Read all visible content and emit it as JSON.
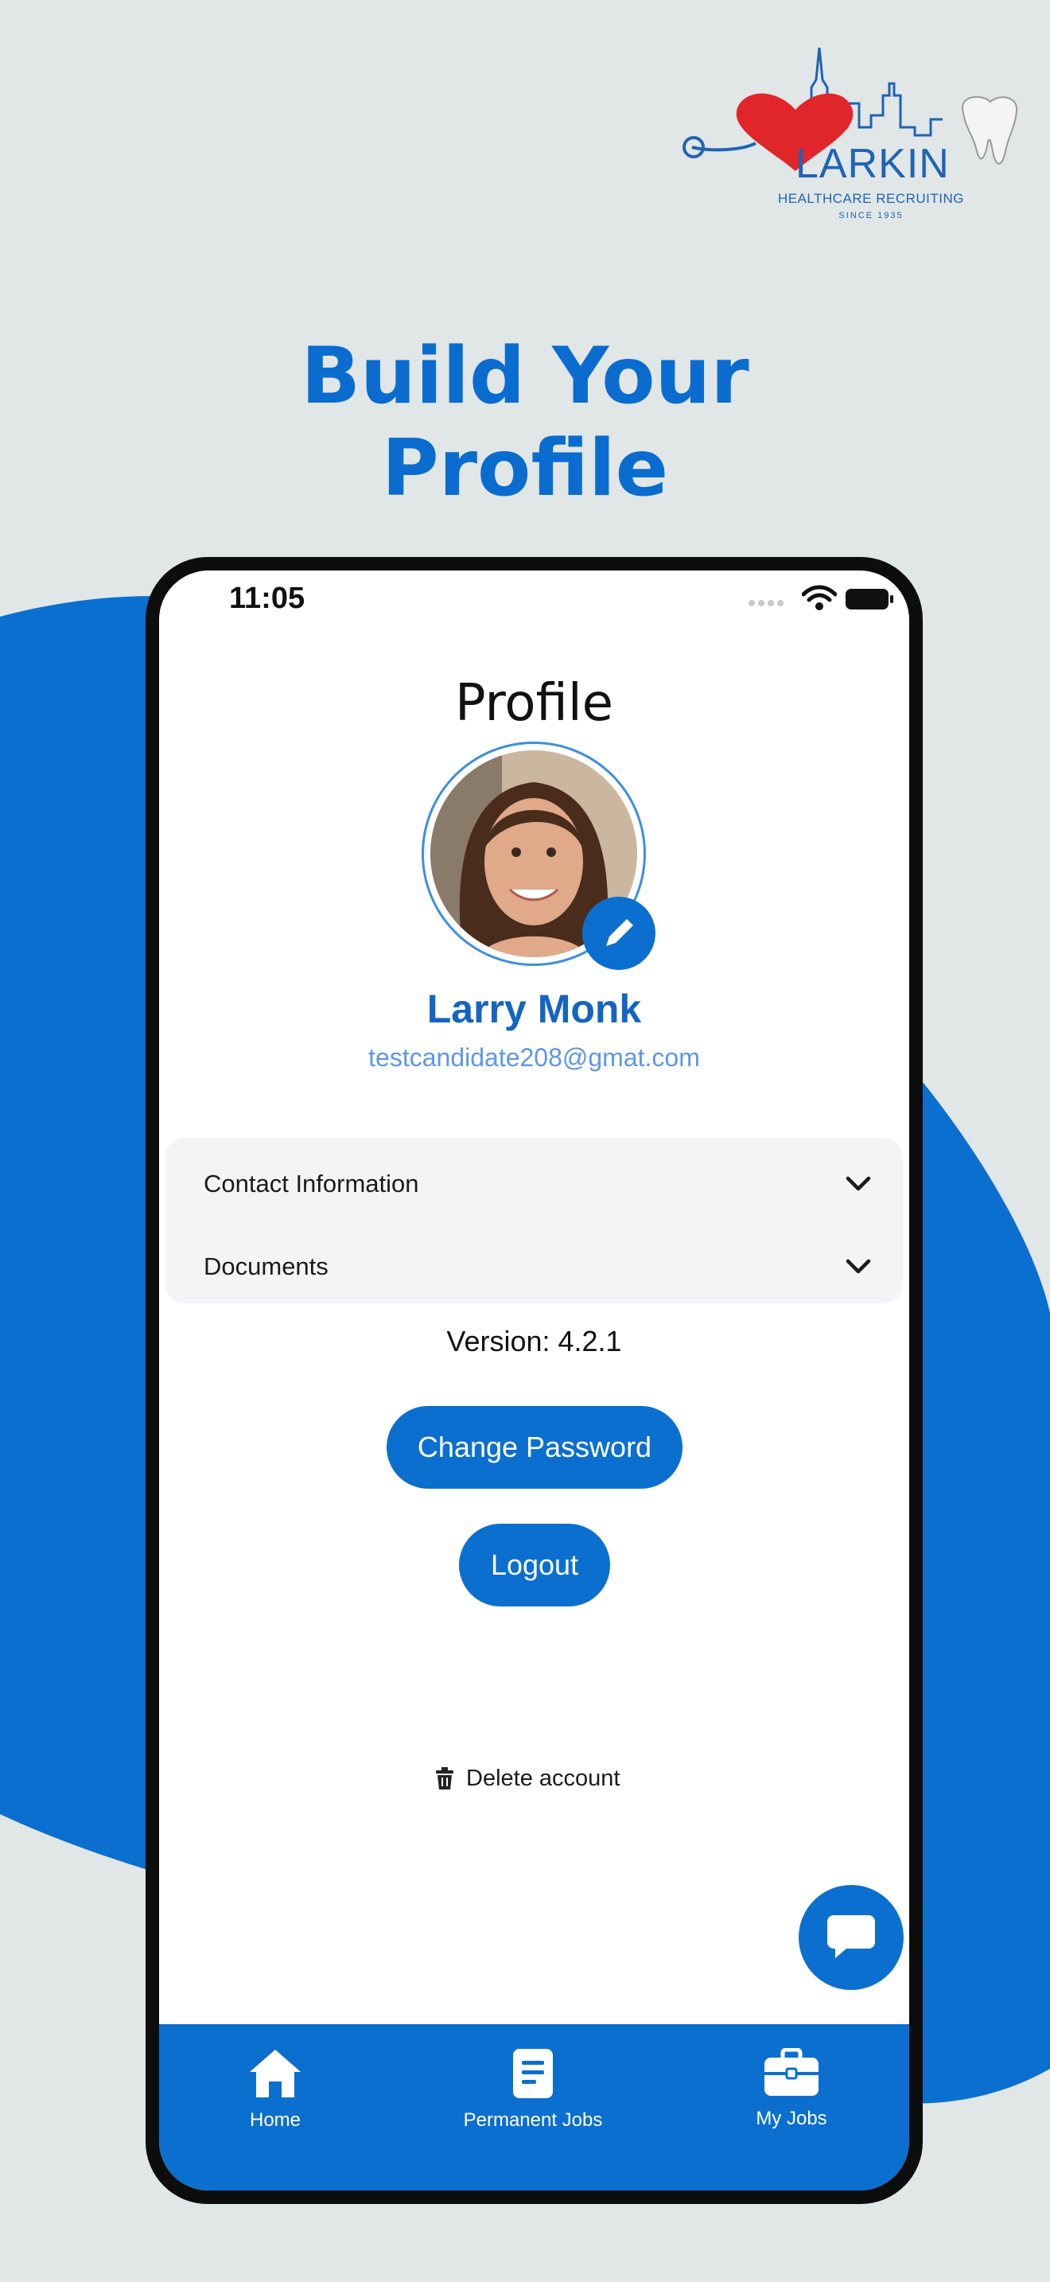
{
  "brand": {
    "name": "LARKIN",
    "subtitle": "HEALTHCARE RECRUITING",
    "since": "SINCE 1935"
  },
  "headline": {
    "line1": "Build Your",
    "line2": "Profile"
  },
  "status_bar": {
    "time": "11:05"
  },
  "profile": {
    "title": "Profile",
    "name": "Larry Monk",
    "email": "testcandidate208@gmat.com"
  },
  "sections": [
    {
      "label": "Contact Information",
      "icon": "chevron-down-icon"
    },
    {
      "label": "Documents",
      "icon": "chevron-down-icon"
    }
  ],
  "version": "Version: 4.2.1",
  "buttons": {
    "change_password": "Change Password",
    "logout": "Logout"
  },
  "delete_account": {
    "label": "Delete account",
    "icon": "trash-icon"
  },
  "tabs": [
    {
      "label": "Home",
      "icon": "home-icon"
    },
    {
      "label": "Permanent Jobs",
      "icon": "document-icon"
    },
    {
      "label": "My Jobs",
      "icon": "briefcase-icon"
    }
  ],
  "colors": {
    "primary": "#0B6FCF",
    "headline": "#0A6CCF",
    "background": "#E1E6E7",
    "name": "#1565C0",
    "email": "#5E97E6",
    "logo_heart": "#E0262B"
  }
}
